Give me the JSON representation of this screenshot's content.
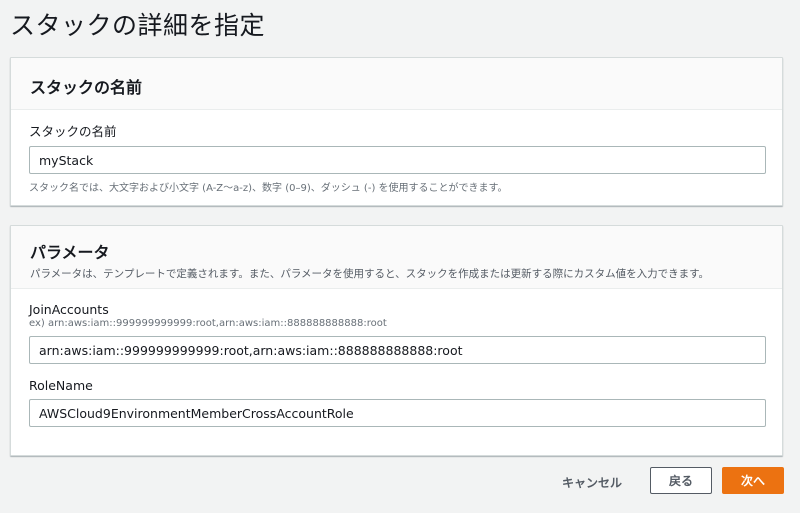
{
  "page": {
    "title": "スタックの詳細を指定"
  },
  "stack_name_section": {
    "title": "スタックの名前",
    "field_label": "スタックの名前",
    "value": "myStack",
    "help": "スタック名では、大文字および小文字 (A-Z〜a-z)、数字 (0–9)、ダッシュ (-) を使用することができます。"
  },
  "parameters_section": {
    "title": "パラメータ",
    "description": "パラメータは、テンプレートで定義されます。また、パラメータを使用すると、スタックを作成または更新する際にカスタム値を入力できます。",
    "fields": [
      {
        "label": "JoinAccounts",
        "hint": "ex) arn:aws:iam::999999999999:root,arn:aws:iam::888888888888:root",
        "value": "arn:aws:iam::999999999999:root,arn:aws:iam::888888888888:root"
      },
      {
        "label": "RoleName",
        "value": "AWSCloud9EnvironmentMemberCrossAccountRole"
      }
    ]
  },
  "footer": {
    "cancel_label": "キャンセル",
    "back_label": "戻る",
    "next_label": "次へ"
  },
  "colors": {
    "primary_button": "#ec7211",
    "background": "#f2f3f3"
  }
}
